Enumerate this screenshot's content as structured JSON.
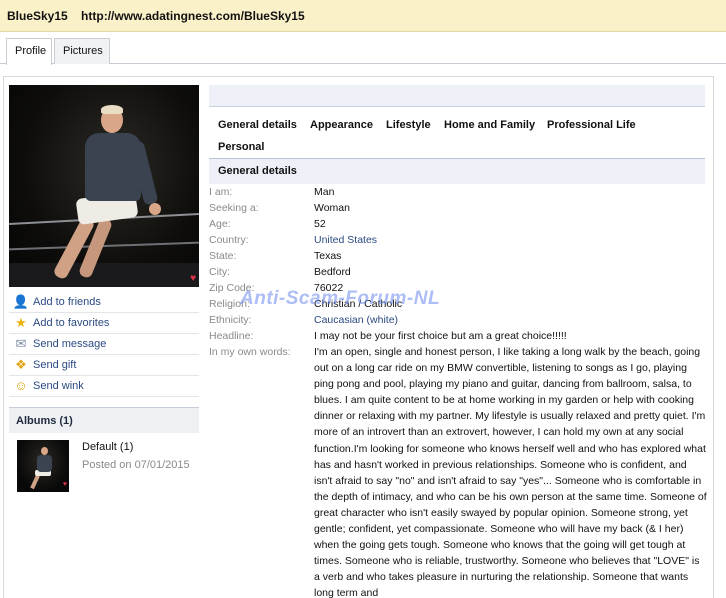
{
  "header": {
    "username": "BlueSky15",
    "url": "http://www.adatingnest.com/BlueSky15"
  },
  "tabs": [
    {
      "label": "Profile",
      "active": true
    },
    {
      "label": "Pictures",
      "active": false
    }
  ],
  "sidebar": {
    "actions": [
      {
        "label": "Add to friends",
        "icon": "user-icon"
      },
      {
        "label": "Add to favorites",
        "icon": "star-icon"
      },
      {
        "label": "Send message",
        "icon": "envelope-icon"
      },
      {
        "label": "Send gift",
        "icon": "gift-icon"
      },
      {
        "label": "Send wink",
        "icon": "wink-icon"
      }
    ],
    "albums": {
      "heading": "Albums (1)",
      "items": [
        {
          "name": "Default (1)",
          "date": "Posted on 07/01/2015"
        }
      ]
    }
  },
  "section_nav": [
    "General details",
    "Appearance",
    "Lifestyle",
    "Home and Family",
    "Professional Life",
    "Personal"
  ],
  "general_details": {
    "heading": "General details",
    "fields": {
      "i_am": {
        "label": "I am:",
        "value": "Man"
      },
      "seeking": {
        "label": "Seeking a:",
        "value": "Woman"
      },
      "age": {
        "label": "Age:",
        "value": "52"
      },
      "country": {
        "label": "Country:",
        "value": "United States"
      },
      "state": {
        "label": "State:",
        "value": "Texas"
      },
      "city": {
        "label": "City:",
        "value": "Bedford"
      },
      "zip": {
        "label": "Zip Code:",
        "value": "76022"
      },
      "religion": {
        "label": "Religion:",
        "value": "Christian / Catholic"
      },
      "ethnicity": {
        "label": "Ethnicity:",
        "value": "Caucasian (white)"
      },
      "headline": {
        "label": "Headline:",
        "value": "I may not be your first choice but am a great choice!!!!!"
      },
      "own_words": {
        "label": "In my own words:",
        "value": "I'm an open, single and honest person, I like taking a long walk by the beach, going out on a long car ride on my BMW convertible, listening to songs as I go, playing ping pong and pool, playing my piano and guitar, dancing from ballroom, salsa, to blues. I am quite content to be at home working in my garden or help with cooking dinner or relaxing with my partner. My lifestyle is usually relaxed and pretty quiet. I'm more of an introvert than an extrovert, however, I can hold my own at any social function.I'm looking for someone who knows herself well and who has explored what has and hasn't worked in previous relationships. Someone who is confident, and isn't afraid to say \"no\" and isn't afraid to say \"yes\"... Someone who is comfortable in the depth of intimacy, and who can be his own person at the same time. Someone of great character who isn't easily swayed by popular opinion. Someone strong, yet gentle; confident, yet compassionate. Someone who will have my back (& I her) when the going gets tough. Someone who knows that the going will get tough at times. Someone who is reliable, trustworthy. Someone who believes that \"LOVE\" is a verb and who takes pleasure in nurturing the relationship. Someone that wants long term and"
      }
    }
  },
  "watermark": "Anti-Scam-Forum-NL",
  "colors": {
    "header_bg": "#fbf1c9",
    "link": "#2b4a82",
    "label_gray": "#8a8a8a",
    "section_bg": "#edf0f6",
    "watermark": "#6a86ec"
  }
}
